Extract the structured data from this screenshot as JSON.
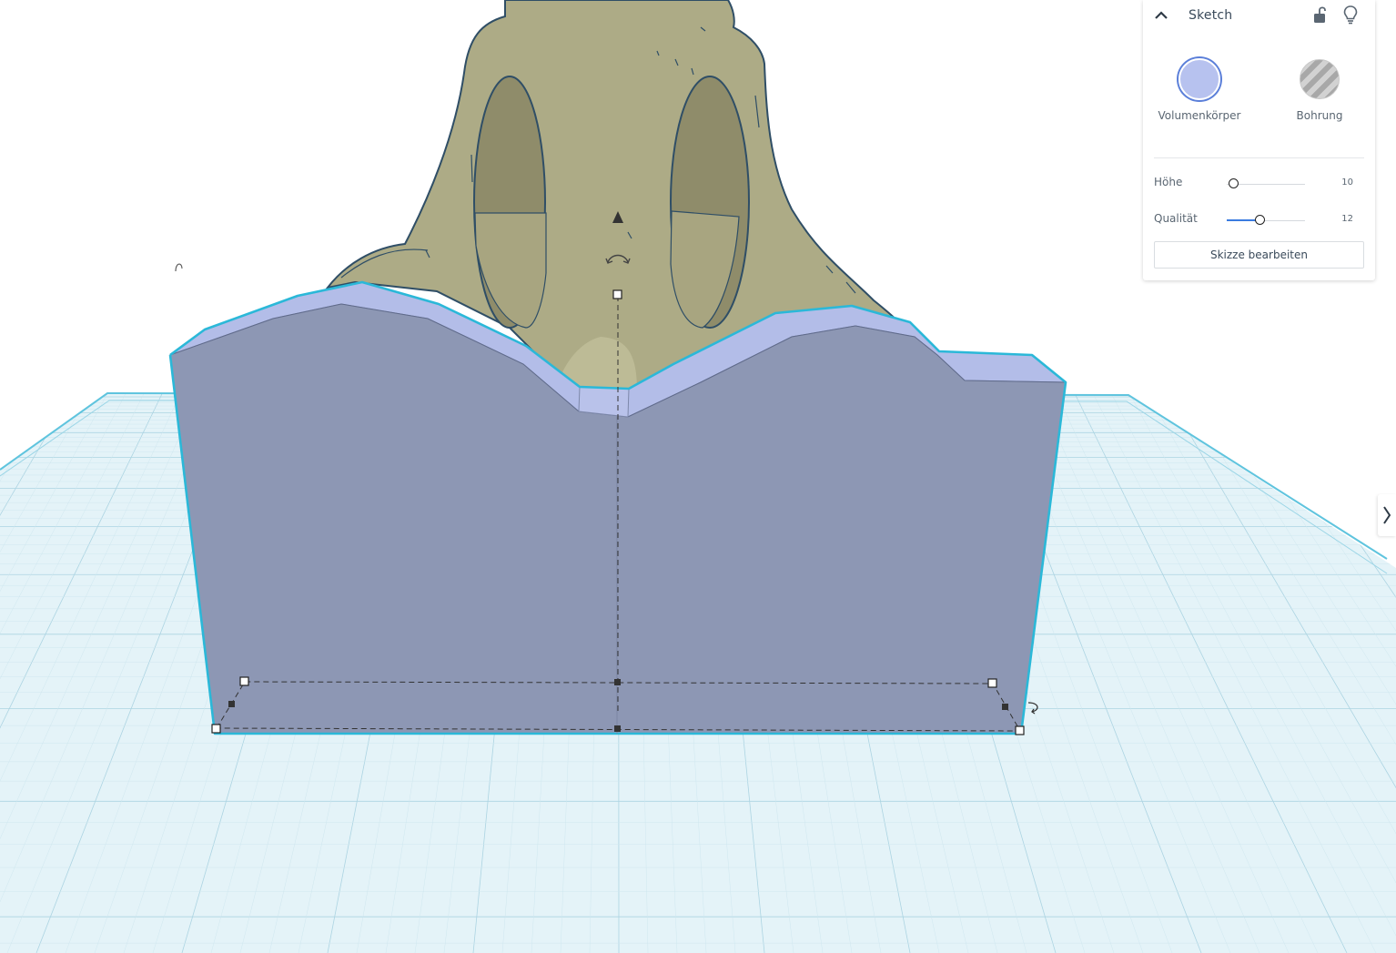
{
  "colors": {
    "grid_fill": "#dff1f7",
    "grid_line": "#a9d3e2",
    "workplane_edge": "#5fc4de",
    "shape_face": "#8d97b4",
    "shape_top": "#b3bde8",
    "selection_outline": "#2bb8d8",
    "figure_body": "#aeac88",
    "figure_outline": "#2f4e66",
    "accent_blue": "#3a7be0"
  },
  "inspector": {
    "title": "Sketch",
    "collapse_icon": "chevron-up-icon",
    "lock_icon": "unlock-icon",
    "bulb_icon": "lightbulb-icon",
    "modes": [
      {
        "id": "solid",
        "label": "Volumenkörper",
        "selected": true
      },
      {
        "id": "hole",
        "label": "Bohrung",
        "selected": false
      }
    ],
    "properties": [
      {
        "label": "Höhe",
        "value": "10",
        "slider_fraction": 0.08
      },
      {
        "label": "Qualität",
        "value": "12",
        "slider_fraction": 0.42
      }
    ],
    "edit_button_label": "Skizze bearbeiten"
  },
  "side_panel_toggle_icon": "chevron-right-icon"
}
